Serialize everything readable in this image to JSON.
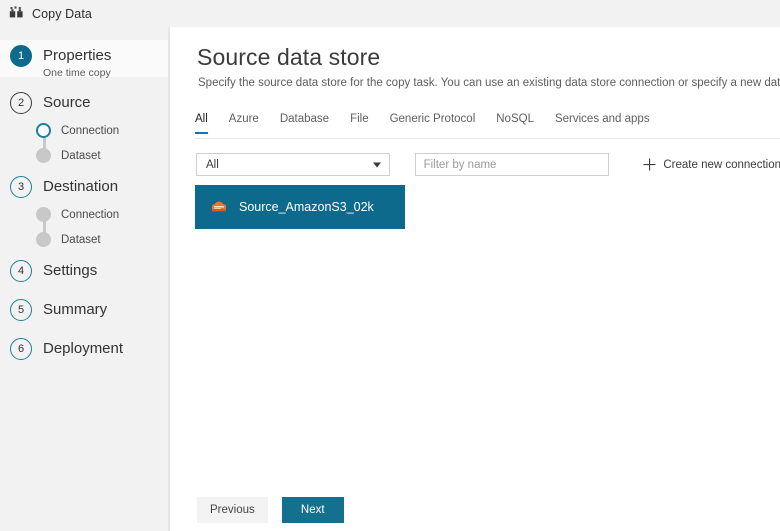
{
  "window": {
    "title": "Copy Data",
    "icon": "copy-data-icon"
  },
  "sidebar": {
    "steps": [
      {
        "number": "1",
        "label": "Properties",
        "sublabel": "One time copy",
        "state": "completed",
        "substeps": []
      },
      {
        "number": "2",
        "label": "Source",
        "sublabel": "",
        "state": "current",
        "substeps": [
          {
            "label": "Connection",
            "state": "active"
          },
          {
            "label": "Dataset",
            "state": "pending"
          }
        ]
      },
      {
        "number": "3",
        "label": "Destination",
        "sublabel": "",
        "state": "upcoming",
        "substeps": [
          {
            "label": "Connection",
            "state": "pending"
          },
          {
            "label": "Dataset",
            "state": "pending"
          }
        ]
      },
      {
        "number": "4",
        "label": "Settings",
        "sublabel": "",
        "state": "upcoming",
        "substeps": []
      },
      {
        "number": "5",
        "label": "Summary",
        "sublabel": "",
        "state": "upcoming",
        "substeps": []
      },
      {
        "number": "6",
        "label": "Deployment",
        "sublabel": "",
        "state": "upcoming",
        "substeps": []
      }
    ]
  },
  "main": {
    "title": "Source data store",
    "description": "Specify the source data store for the copy task. You can use an existing data store connection or specify a new data store.",
    "tabs": [
      {
        "label": "All",
        "active": true
      },
      {
        "label": "Azure",
        "active": false
      },
      {
        "label": "Database",
        "active": false
      },
      {
        "label": "File",
        "active": false
      },
      {
        "label": "Generic Protocol",
        "active": false
      },
      {
        "label": "NoSQL",
        "active": false
      },
      {
        "label": "Services and apps",
        "active": false
      }
    ],
    "filter": {
      "select_value": "All",
      "search_placeholder": "Filter by name",
      "create_label": "Create new connection",
      "create_icon": "plus-icon"
    },
    "connections": [
      {
        "name": "Source_AmazonS3_02k",
        "icon": "amazon-s3-icon",
        "selected": true
      }
    ]
  },
  "footer": {
    "previous_label": "Previous",
    "next_label": "Next"
  },
  "colors": {
    "accent_teal": "#0e6a8d",
    "primary_button": "#14708f",
    "tab_underline": "#0b79bf",
    "sidebar_bg": "#f2f2f2",
    "s3_orange": "#e8762d"
  }
}
